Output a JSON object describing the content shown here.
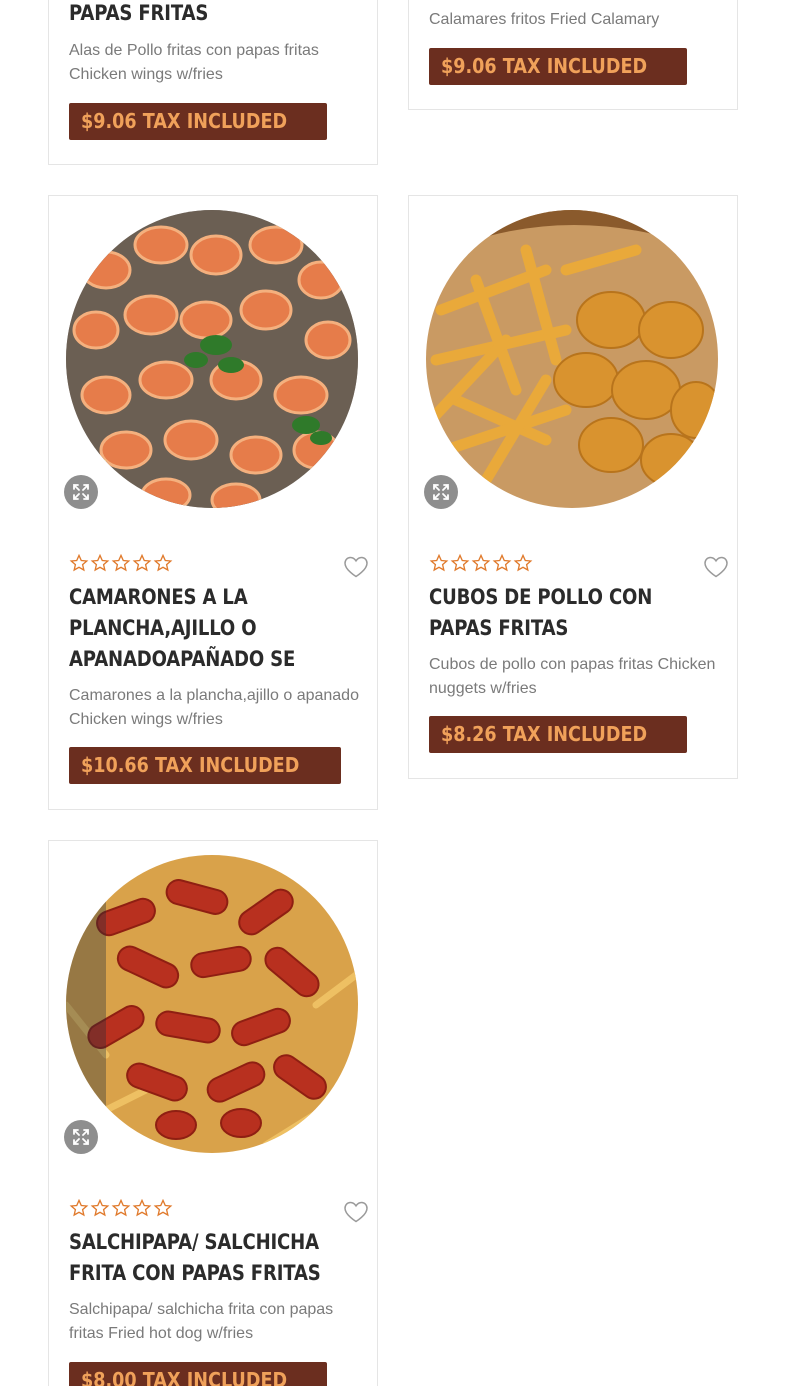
{
  "accent_color": "#6b2e1f",
  "price_text_color": "#f0a15a",
  "star_color": "#e07a2c",
  "products": [
    {
      "title": "PAPAS FRITAS",
      "description": "Alas de Pollo fritas con papas fritas Chicken wings w/fries",
      "price": "$9.06 TAX INCLUDED"
    },
    {
      "title": "",
      "description": "Calamares fritos Fried Calamary",
      "price": "$9.06 TAX INCLUDED"
    },
    {
      "title": "CAMARONES A LA PLANCHA,AJILLO O APANADOAPAÑADO SE",
      "description": "Camarones a la plancha,ajillo o apanado Chicken wings w/fries",
      "price": "$10.66 TAX INCLUDED",
      "image": "shrimp-photo",
      "rating_stars": 0
    },
    {
      "title": "CUBOS DE POLLO CON PAPAS FRITAS",
      "description": "Cubos de pollo con papas fritas Chicken nuggets w/fries",
      "price": "$8.26 TAX INCLUDED",
      "image": "chicken-nuggets-photo",
      "rating_stars": 0
    },
    {
      "title": "SALCHIPAPA/ SALCHICHA FRITA CON PAPAS FRITAS",
      "description": "Salchipapa/ salchicha frita con papas fritas Fried hot dog w/fries",
      "price": "$8.00 TAX INCLUDED",
      "image": "salchipapa-photo",
      "rating_stars": 0
    }
  ]
}
